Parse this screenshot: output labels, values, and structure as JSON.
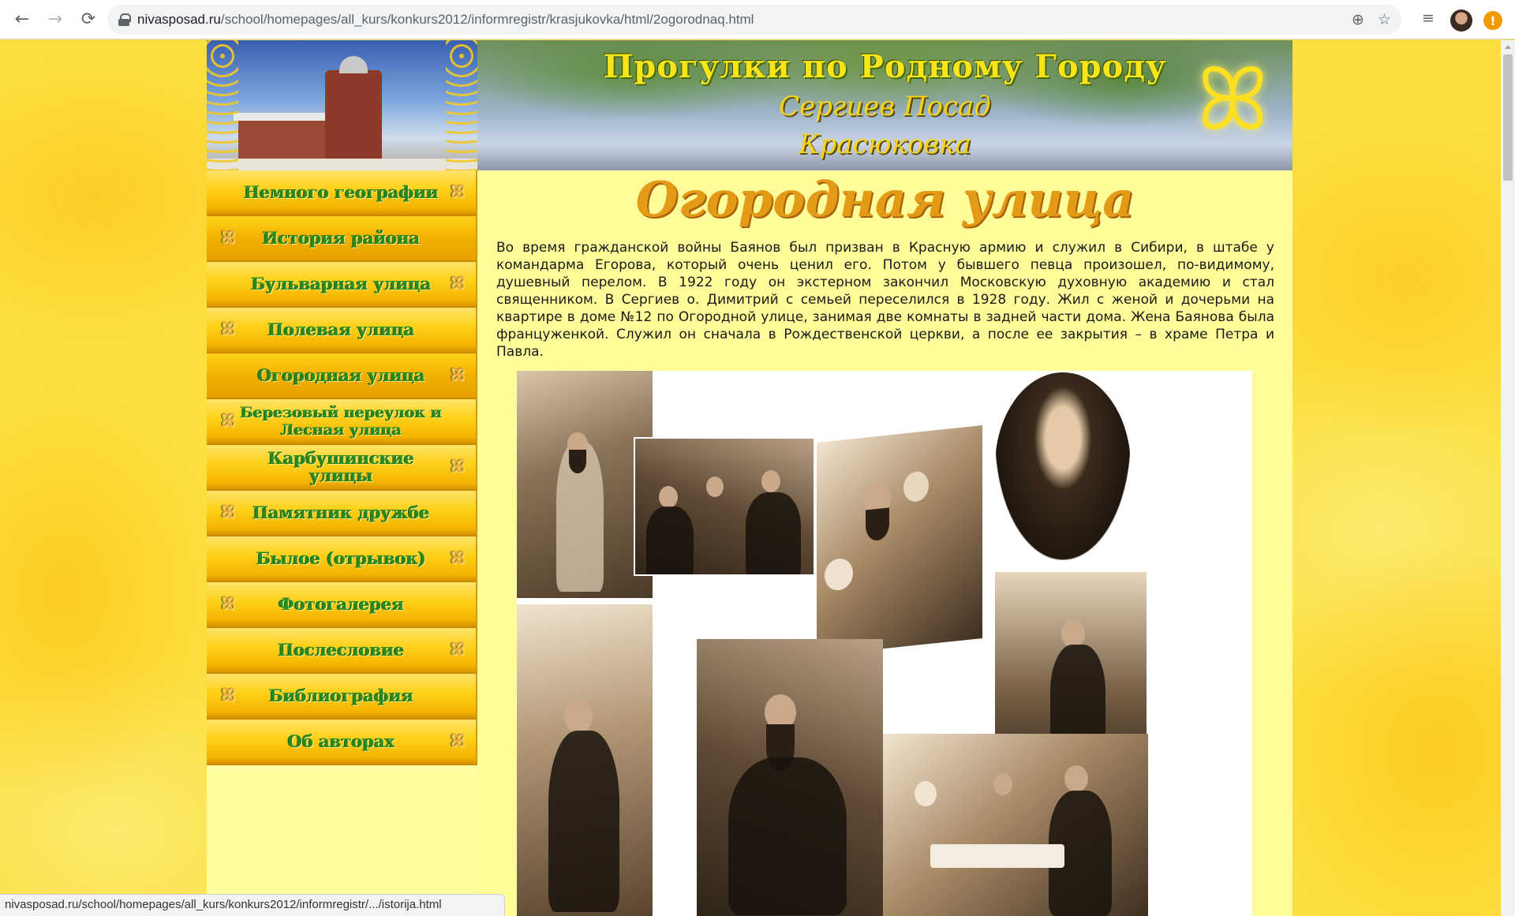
{
  "browser": {
    "url_domain": "nivasposad.ru",
    "url_path": "/school/homepages/all_kurs/konkurs2012/informregistr/krasjukovka/html/2ogorodnaq.html",
    "back_glyph": "←",
    "forward_glyph": "→",
    "reload_glyph": "⟳",
    "zoom_glyph": "⊕",
    "star_glyph": "☆",
    "media_glyph": "≡",
    "alert_glyph": "!"
  },
  "status_bar": {
    "text": "nivasposad.ru/school/homepages/all_kurs/konkurs2012/informregistr/.../istorija.html"
  },
  "banner": {
    "title": "Прогулки по Родному Городу",
    "subtitle_1": "Сергиев Посад",
    "subtitle_2": "Красюковка",
    "butterfly_glyph": "ꕤ"
  },
  "menu": {
    "butterfly_glyph": "ꕤ",
    "items": [
      {
        "label": "Немного географии",
        "butterfly": "right"
      },
      {
        "label": "История района",
        "butterfly": "left"
      },
      {
        "label": "Бульварная улица",
        "butterfly": "right"
      },
      {
        "label": "Полевая улица",
        "butterfly": "left"
      },
      {
        "label": "Огородная улица",
        "butterfly": "right"
      },
      {
        "label": "Березовый переулок и Лесная улица",
        "butterfly": "left"
      },
      {
        "label": "Карбушинские улицы",
        "butterfly": "right"
      },
      {
        "label": "Памятник дружбе",
        "butterfly": "left"
      },
      {
        "label": "Былое (отрывок)",
        "butterfly": "right"
      },
      {
        "label": "Фотогалерея",
        "butterfly": "left"
      },
      {
        "label": "Послесловие",
        "butterfly": "right"
      },
      {
        "label": "Библиография",
        "butterfly": "left"
      },
      {
        "label": "Об авторах",
        "butterfly": "right"
      }
    ]
  },
  "page": {
    "heading": "Огородная улица",
    "paragraph": "Во время гражданской войны Баянов был призван в Красную армию и служил в Сибири, в штабе у командарма Егорова, который очень ценил его. Потом у бывшего певца произошел, по-видимому, душевный перелом. В 1922 году он экстерном закончил Московскую духовную академию и стал священником. В Сергиев о. Димитрий с семьей переселился в 1928 году. Жил с женой и дочерьми на квартире в доме №12 по Огородной улице, занимая две комнаты в задней части дома. Жена Баянова была француженкой. Служил он сначала в Рождественской церкви, а после ее закрытия – в храме Петра и Павла."
  },
  "colors": {
    "menu_text": "#2b8a1e",
    "heading": "#e39a16",
    "page_bg": "#fbdf3e",
    "content_bg": "#fffc9a"
  }
}
